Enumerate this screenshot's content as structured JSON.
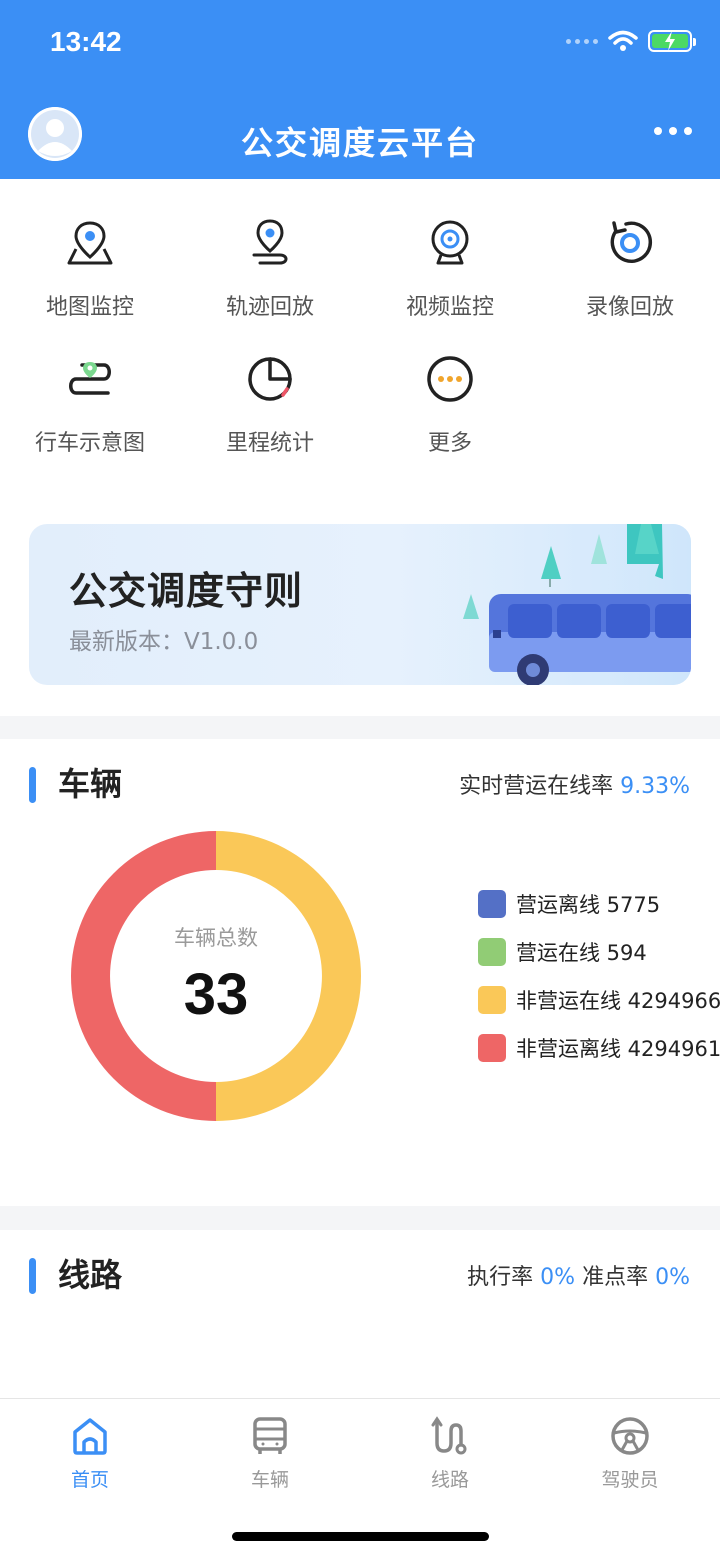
{
  "status_bar": {
    "time": "13:42"
  },
  "header": {
    "title": "公交调度云平台"
  },
  "menu": [
    {
      "label": "地图监控",
      "icon": "map-pin-icon"
    },
    {
      "label": "轨迹回放",
      "icon": "track-pin-icon"
    },
    {
      "label": "视频监控",
      "icon": "camera-icon"
    },
    {
      "label": "录像回放",
      "icon": "replay-icon"
    },
    {
      "label": "行车示意图",
      "icon": "route-diagram-icon"
    },
    {
      "label": "里程统计",
      "icon": "pie-chart-icon"
    },
    {
      "label": "更多",
      "icon": "more-icon"
    }
  ],
  "banner": {
    "title": "公交调度守则",
    "subtitle": "最新版本：V1.0.0"
  },
  "vehicle": {
    "title": "车辆",
    "online_rate_label": "实时营运在线率",
    "online_rate_value": "9.33%",
    "donut_caption": "车辆总数",
    "total": "33",
    "legend": [
      {
        "text": "营运离线 5775",
        "color": "#5470c6"
      },
      {
        "text": "营运在线 594",
        "color": "#91cc75"
      },
      {
        "text": "非营运在线 4294966",
        "color": "#fac858"
      },
      {
        "text": "非营运离线 4294961",
        "color": "#ee6666"
      }
    ]
  },
  "chart_data": {
    "type": "pie",
    "title": "车辆总数",
    "categories": [
      "营运离线",
      "营运在线",
      "非营运在线",
      "非营运离线"
    ],
    "values": [
      0,
      0,
      50,
      50
    ],
    "colors": [
      "#5470c6",
      "#91cc75",
      "#fac858",
      "#ee6666"
    ]
  },
  "route": {
    "title": "线路",
    "exec_label": "执行率",
    "exec_value": "0%",
    "ontime_label": "准点率",
    "ontime_value": "0%"
  },
  "tabs": [
    {
      "label": "首页",
      "icon": "home-icon",
      "active": true
    },
    {
      "label": "车辆",
      "icon": "bus-icon",
      "active": false
    },
    {
      "label": "线路",
      "icon": "route-icon",
      "active": false
    },
    {
      "label": "驾驶员",
      "icon": "steering-wheel-icon",
      "active": false
    }
  ],
  "colors": {
    "primary": "#3b8ff5"
  }
}
